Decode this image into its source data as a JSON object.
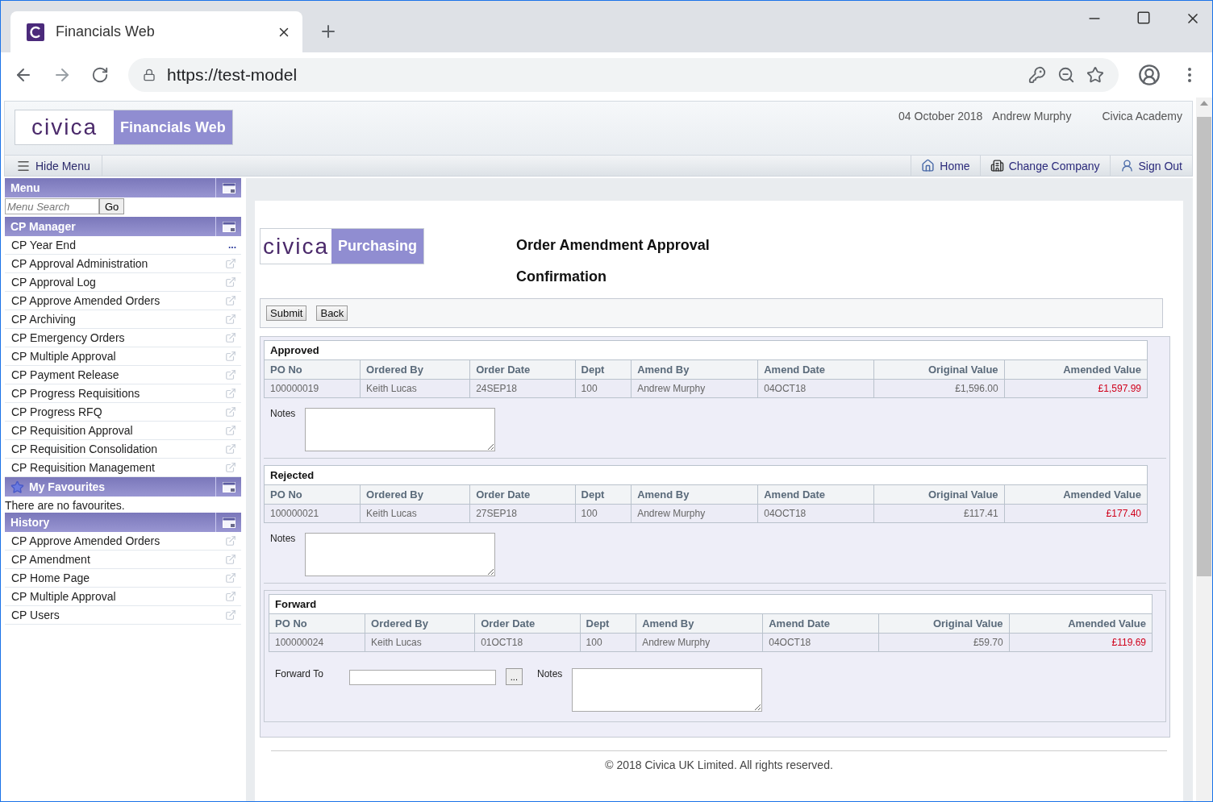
{
  "browser": {
    "tab_title": "Financials Web",
    "url": "https://test-model"
  },
  "header": {
    "logo": "civica",
    "product": "Financials Web",
    "date": "04 October 2018",
    "user": "Andrew Murphy",
    "company": "Civica Academy",
    "hide_menu": "Hide Menu",
    "nav": [
      {
        "kind": "home",
        "label": "Home"
      },
      {
        "kind": "company",
        "label": "Change Company"
      },
      {
        "kind": "signout",
        "label": "Sign Out"
      }
    ]
  },
  "sidebar": {
    "menu_title": "Menu",
    "search_placeholder": "Menu Search",
    "go": "Go",
    "manager": {
      "title": "CP Manager",
      "items": [
        {
          "label": "CP Year End",
          "suffix": "..."
        },
        {
          "label": "CP Approval Administration"
        },
        {
          "label": "CP Approval Log"
        },
        {
          "label": "CP Approve Amended Orders"
        },
        {
          "label": "CP Archiving"
        },
        {
          "label": "CP Emergency Orders"
        },
        {
          "label": "CP Multiple Approval"
        },
        {
          "label": "CP Payment Release"
        },
        {
          "label": "CP Progress Requisitions"
        },
        {
          "label": "CP Progress RFQ"
        },
        {
          "label": "CP Requisition Approval"
        },
        {
          "label": "CP Requisition Consolidation"
        },
        {
          "label": "CP Requisition Management"
        }
      ]
    },
    "favourites": {
      "title": "My Favourites",
      "empty": "There are no favourites."
    },
    "history": {
      "title": "History",
      "items": [
        {
          "label": "CP Approve Amended Orders"
        },
        {
          "label": "CP Amendment"
        },
        {
          "label": "CP Home Page"
        },
        {
          "label": "CP Multiple Approval"
        },
        {
          "label": "CP Users"
        }
      ]
    }
  },
  "main": {
    "logo": "civica",
    "module": "Purchasing",
    "title": "Order Amendment Approval",
    "subtitle": "Confirmation",
    "buttons": [
      "Submit",
      "Back"
    ],
    "sections": [
      {
        "kind": "notes",
        "title": "Approved",
        "columns": [
          "PO No",
          "Ordered By",
          "Order Date",
          "Dept",
          "Amend By",
          "Amend Date",
          "Original Value",
          "Amended Value"
        ],
        "cells": [
          {
            "kind": "text",
            "text": "100000019"
          },
          {
            "kind": "text",
            "text": "Keith Lucas"
          },
          {
            "kind": "text",
            "text": "24SEP18"
          },
          {
            "kind": "text",
            "text": "100"
          },
          {
            "kind": "text",
            "text": "Andrew Murphy"
          },
          {
            "kind": "text",
            "text": "04OCT18"
          },
          {
            "kind": "money",
            "text": "£1,596.00"
          },
          {
            "kind": "changed",
            "text": "£1,597.99"
          }
        ],
        "notes_label": "Notes"
      },
      {
        "kind": "notes",
        "title": "Rejected",
        "columns": [
          "PO No",
          "Ordered By",
          "Order Date",
          "Dept",
          "Amend By",
          "Amend Date",
          "Original Value",
          "Amended Value"
        ],
        "cells": [
          {
            "kind": "text",
            "text": "100000021"
          },
          {
            "kind": "text",
            "text": "Keith Lucas"
          },
          {
            "kind": "text",
            "text": "27SEP18"
          },
          {
            "kind": "text",
            "text": "100"
          },
          {
            "kind": "text",
            "text": "Andrew Murphy"
          },
          {
            "kind": "text",
            "text": "04OCT18"
          },
          {
            "kind": "money",
            "text": "£117.41"
          },
          {
            "kind": "changed",
            "text": "£177.40"
          }
        ],
        "notes_label": "Notes"
      },
      {
        "kind": "forward",
        "title": "Forward",
        "columns": [
          "PO No",
          "Ordered By",
          "Order Date",
          "Dept",
          "Amend By",
          "Amend Date",
          "Original Value",
          "Amended Value"
        ],
        "cells": [
          {
            "kind": "text",
            "text": "100000024"
          },
          {
            "kind": "text",
            "text": "Keith Lucas"
          },
          {
            "kind": "text",
            "text": "01OCT18"
          },
          {
            "kind": "text",
            "text": "100"
          },
          {
            "kind": "text",
            "text": "Andrew Murphy"
          },
          {
            "kind": "text",
            "text": "04OCT18"
          },
          {
            "kind": "money",
            "text": "£59.70"
          },
          {
            "kind": "changed",
            "text": "£119.69"
          }
        ],
        "forward_label": "Forward To",
        "lookup": "...",
        "notes_label": "Notes"
      }
    ]
  },
  "footer": "© 2018 Civica UK Limited. All rights reserved."
}
